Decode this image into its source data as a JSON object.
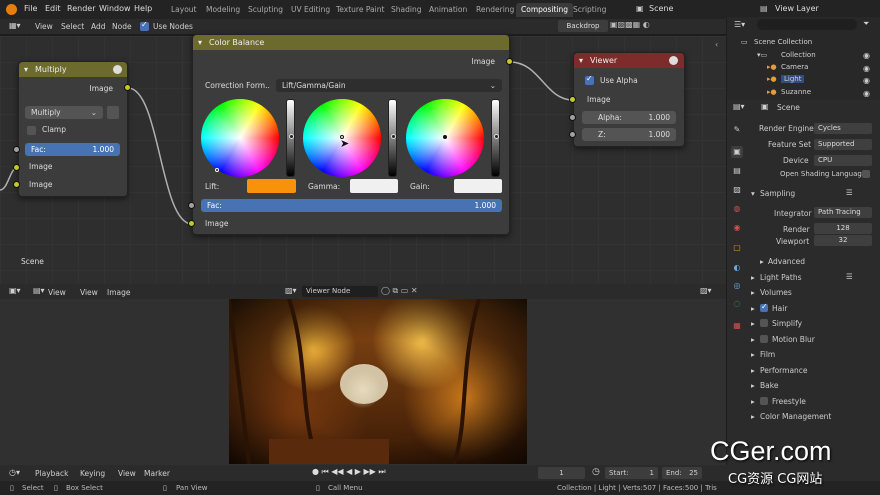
{
  "topbar": {
    "menus": [
      "File",
      "Edit",
      "Render",
      "Window",
      "Help"
    ],
    "workspaces": [
      "Layout",
      "Modeling",
      "Sculpting",
      "UV Editing",
      "Texture Paint",
      "Shading",
      "Animation",
      "Rendering",
      "Compositing",
      "Scripting"
    ],
    "scene": "Scene",
    "view_layer": "View Layer"
  },
  "node_editor": {
    "header": {
      "view": "View",
      "select": "Select",
      "add": "Add",
      "node": "Node",
      "use_nodes": "Use Nodes",
      "backdrop": "Backdrop"
    },
    "scene_label": "Scene",
    "multiply": {
      "title": "Multiply",
      "image_out": "Image",
      "blend": "Multiply",
      "clamp": "Clamp",
      "fac_label": "Fac:",
      "fac_value": "1.000",
      "image1": "Image",
      "image2": "Image"
    },
    "color_balance": {
      "title": "Color Balance",
      "image_out": "Image",
      "correction_label": "Correction Form..",
      "correction_value": "Lift/Gamma/Gain",
      "lift": "Lift:",
      "gamma": "Gamma:",
      "gain": "Gain:",
      "fac_label": "Fac:",
      "fac_value": "1.000",
      "image_in": "Image",
      "lift_color": "#f7920a",
      "gamma_color": "#f0f0f0",
      "gain_color": "#f0f0f0"
    },
    "viewer": {
      "title": "Viewer",
      "use_alpha": "Use Alpha",
      "image_in": "Image",
      "alpha_label": "Alpha:",
      "alpha_value": "1.000",
      "z_label": "Z:",
      "z_value": "1.000"
    }
  },
  "image_editor": {
    "header": {
      "view": "View",
      "view2": "View",
      "image": "Image",
      "image_name": "Viewer Node"
    }
  },
  "outliner": {
    "title": "Scene Collection",
    "items": [
      "Collection",
      "Camera",
      "Light",
      "Suzanne"
    ]
  },
  "properties": {
    "scene": "Scene",
    "render_engine_label": "Render Engine",
    "render_engine": "Cycles",
    "feature_set_label": "Feature Set",
    "feature_set": "Supported",
    "device_label": "Device",
    "device": "CPU",
    "osl": "Open Shading Language",
    "sampling": "Sampling",
    "integrator_label": "Integrator",
    "integrator": "Path Tracing",
    "render_label": "Render",
    "render_value": "128",
    "viewport_label": "Viewport",
    "viewport_value": "32",
    "advanced": "Advanced",
    "sections": [
      "Light Paths",
      "Volumes",
      "Hair",
      "Simplify",
      "Motion Blur",
      "Film",
      "Performance",
      "Bake",
      "Freestyle",
      "Color Management"
    ]
  },
  "timeline": {
    "playback": "Playback",
    "keying": "Keying",
    "view": "View",
    "marker": "Marker",
    "frame": "1",
    "start_label": "Start:",
    "start": "1",
    "end_label": "End:",
    "end": "25"
  },
  "status": {
    "select": "Select",
    "box_select": "Box Select",
    "pan_view": "Pan View",
    "call_menu": "Call Menu",
    "info": "Collection | Light | Verts:507 | Faces:500 | Tris"
  },
  "watermark": {
    "main": "CGer.com",
    "sub": "CG资源 CG网站"
  }
}
